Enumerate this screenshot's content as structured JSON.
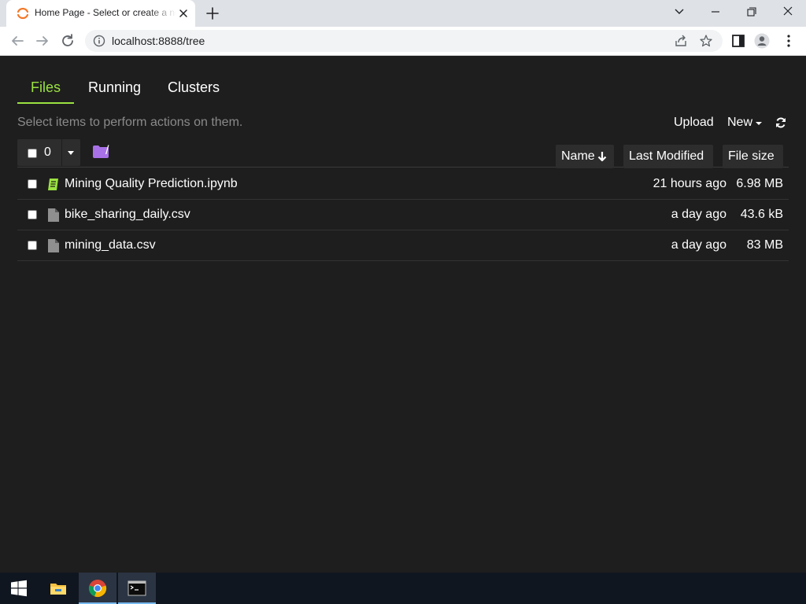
{
  "browser": {
    "tab_title": "Home Page - Select or create a notebook",
    "url": "localhost:8888/tree",
    "new_tab_symbol": "+",
    "colors": {
      "tabstrip": "#dee1e6",
      "tab": "#ffffff",
      "omnibox": "#f1f3f4"
    }
  },
  "jupyter": {
    "tabs": [
      {
        "label": "Files",
        "active": true
      },
      {
        "label": "Running",
        "active": false
      },
      {
        "label": "Clusters",
        "active": false
      }
    ],
    "hint": "Select items to perform actions on them.",
    "upload_label": "Upload",
    "new_label": "New",
    "selected_count": "0",
    "path": "/",
    "columns": {
      "name": "Name",
      "last_modified": "Last Modified",
      "file_size": "File size"
    },
    "files": [
      {
        "name": "Mining Quality Prediction.ipynb",
        "type": "notebook",
        "modified": "21 hours ago",
        "size": "6.98 MB"
      },
      {
        "name": "bike_sharing_daily.csv",
        "type": "file",
        "modified": "a day ago",
        "size": "43.6 kB"
      },
      {
        "name": "mining_data.csv",
        "type": "file",
        "modified": "a day ago",
        "size": "83 MB"
      }
    ],
    "colors": {
      "background": "#1e1e1e",
      "accent": "#9be241",
      "hint": "#8a8a8a",
      "folder": "#a871e8"
    }
  },
  "taskbar": {
    "items": [
      "start-icon",
      "file-explorer-icon",
      "chrome-icon",
      "terminal-icon"
    ],
    "active_item": "chrome-icon"
  }
}
